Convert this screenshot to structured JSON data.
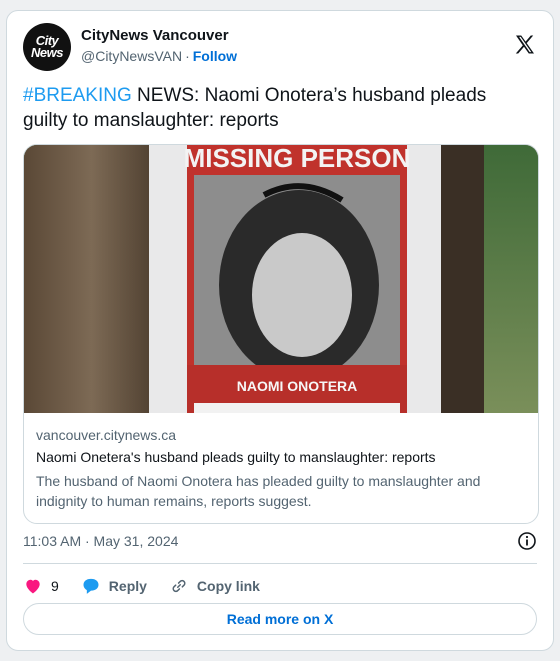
{
  "author": {
    "avatar_line1": "City",
    "avatar_line2": "News",
    "name": "CityNews Vancouver",
    "handle": "@CityNewsVAN",
    "separator": "·",
    "follow_label": "Follow"
  },
  "tweet": {
    "hashtag": "#BREAKING",
    "text_rest": " NEWS: Naomi Onotera’s husband pleads guilty to manslaughter: reports"
  },
  "link_card": {
    "image": {
      "poster_heading": "MISSING PERSON",
      "poster_name": "NAOMI ONOTERA"
    },
    "domain": "vancouver.citynews.ca",
    "title": "Naomi Onetera's husband pleads guilty to manslaughter: reports",
    "description": "The husband of Naomi Onotera has pleaded guilty to manslaughter and indignity to human remains, reports suggest."
  },
  "meta": {
    "timestamp": "11:03 AM · May 31, 2024"
  },
  "actions": {
    "like_count": "9",
    "reply_label": "Reply",
    "copy_link_label": "Copy link"
  },
  "read_more_label": "Read more on X",
  "colors": {
    "link_blue": "#006fd6",
    "hashtag_blue": "#1d9bf0",
    "like_pink": "#f91880",
    "reply_blue": "#1d9bf0",
    "muted_text": "#536471"
  }
}
